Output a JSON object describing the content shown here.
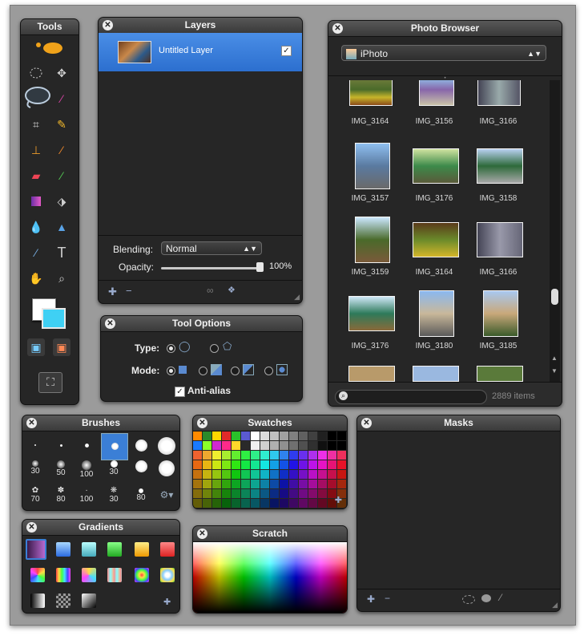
{
  "tools": {
    "title": "Tools"
  },
  "layers": {
    "title": "Layers",
    "layer_name": "Untitled Layer",
    "blending_label": "Blending:",
    "blending_value": "Normal",
    "opacity_label": "Opacity:",
    "opacity_value": "100%",
    "opacity_level": 1.0
  },
  "photo_browser": {
    "title": "Photo Browser",
    "source": "iPhoto",
    "item_count": "2889 items",
    "photos": [
      {
        "name": "IMG_3164"
      },
      {
        "name": "IMG_3156"
      },
      {
        "name": "IMG_3166"
      },
      {
        "name": "IMG_3157"
      },
      {
        "name": "IMG_3176"
      },
      {
        "name": "IMG_3158"
      },
      {
        "name": "IMG_3159"
      },
      {
        "name": "IMG_3164"
      },
      {
        "name": "IMG_3166"
      },
      {
        "name": "IMG_3176"
      },
      {
        "name": "IMG_3180"
      },
      {
        "name": "IMG_3185"
      }
    ]
  },
  "tool_options": {
    "title": "Tool Options",
    "type_label": "Type:",
    "mode_label": "Mode:",
    "antialias_label": "Anti-alias",
    "antialias_checked": true
  },
  "brushes": {
    "title": "Brushes",
    "labels": [
      "",
      "",
      "",
      "",
      "",
      "",
      "30",
      "50",
      "100",
      "30",
      "",
      "",
      "70",
      "80",
      "100",
      "30",
      "80",
      ""
    ]
  },
  "swatches": {
    "title": "Swatches"
  },
  "masks": {
    "title": "Masks"
  },
  "gradients": {
    "title": "Gradients"
  },
  "scratch": {
    "title": "Scratch"
  },
  "colors": {
    "accent": "#3b7fd6",
    "panel": "#262626",
    "foreground_swatch": "#ffffff",
    "background_swatch": "#3fd0f4"
  }
}
